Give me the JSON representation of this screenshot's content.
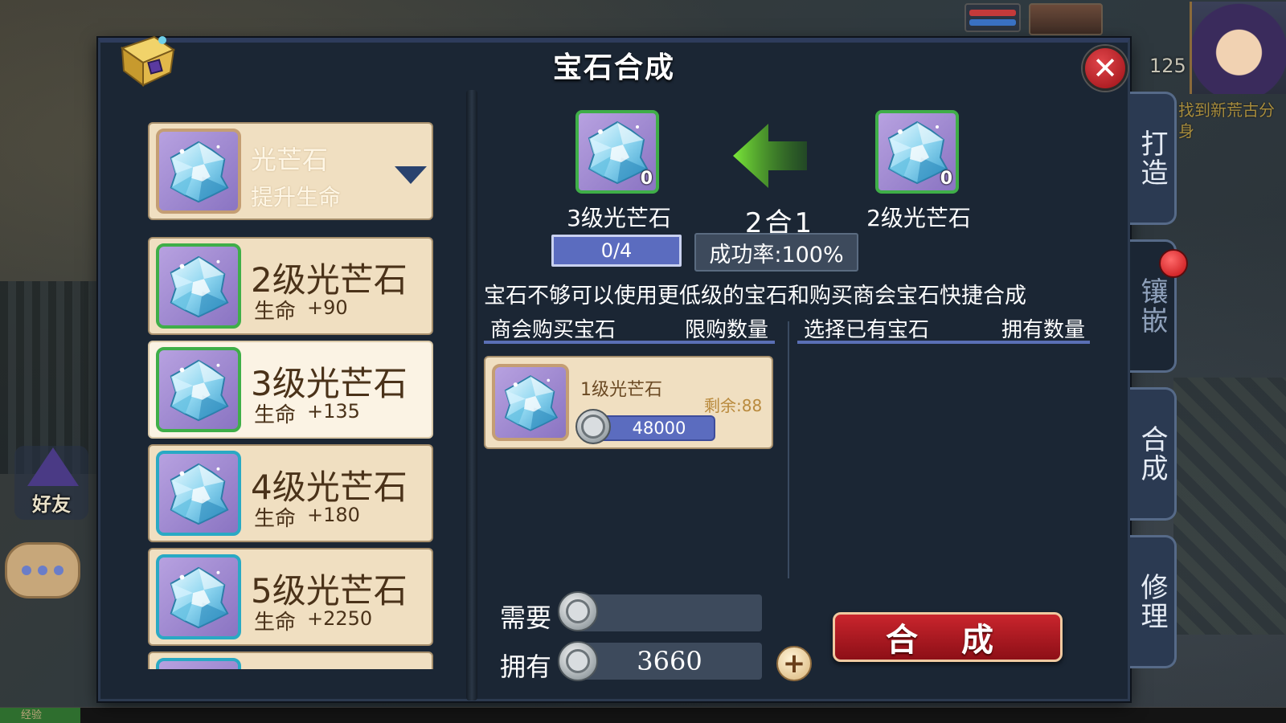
{
  "window": {
    "title": "宝石合成",
    "close_label": "✕"
  },
  "hud": {
    "level": "125",
    "quest_text": "找到新荒古分身",
    "friend_label": "好友",
    "exp_label": "经验"
  },
  "selector": {
    "name": "光芒石",
    "subtitle": "提升生命"
  },
  "gem_list": [
    {
      "name": "2级光芒石",
      "stat_label": "生命",
      "stat_value": "+90",
      "frame": "green"
    },
    {
      "name": "3级光芒石",
      "stat_label": "生命",
      "stat_value": "+135",
      "frame": "green",
      "selected": true
    },
    {
      "name": "4级光芒石",
      "stat_label": "生命",
      "stat_value": "+180",
      "frame": "teal"
    },
    {
      "name": "5级光芒石",
      "stat_label": "生命",
      "stat_value": "+2250",
      "frame": "teal"
    }
  ],
  "synthesis": {
    "source_label": "3级光芒石",
    "source_count": "0",
    "target_label": "2级光芒石",
    "target_count": "0",
    "ratio": "2合1",
    "progress": "0/4",
    "success_rate": "成功率:100%",
    "hint": "宝石不够可以使用更低级的宝石和购买商会宝石快捷合成"
  },
  "columns": {
    "shop_title": "商会购买宝石",
    "shop_limit": "限购数量",
    "owned_title": "选择已有宝石",
    "owned_count": "拥有数量"
  },
  "shop_items": [
    {
      "name": "1级光芒石",
      "remaining": "剩余:88",
      "price": "48000"
    }
  ],
  "cost": {
    "need_label": "需要",
    "need_value": "",
    "have_label": "拥有",
    "have_value": "3660",
    "plus_label": "+"
  },
  "synth_button": "合 成",
  "side_tabs": [
    {
      "label": "打造",
      "active": false
    },
    {
      "label": "镶嵌",
      "active": true
    },
    {
      "label": "合成",
      "active": false
    },
    {
      "label": "修理",
      "active": false
    }
  ],
  "colors": {
    "window_bg": "#1b2634",
    "card_bg": "#f0dfc1",
    "accent_blue": "#5b6cbf",
    "button_red": "#c9252d",
    "arrow_green": "#54c31f"
  }
}
